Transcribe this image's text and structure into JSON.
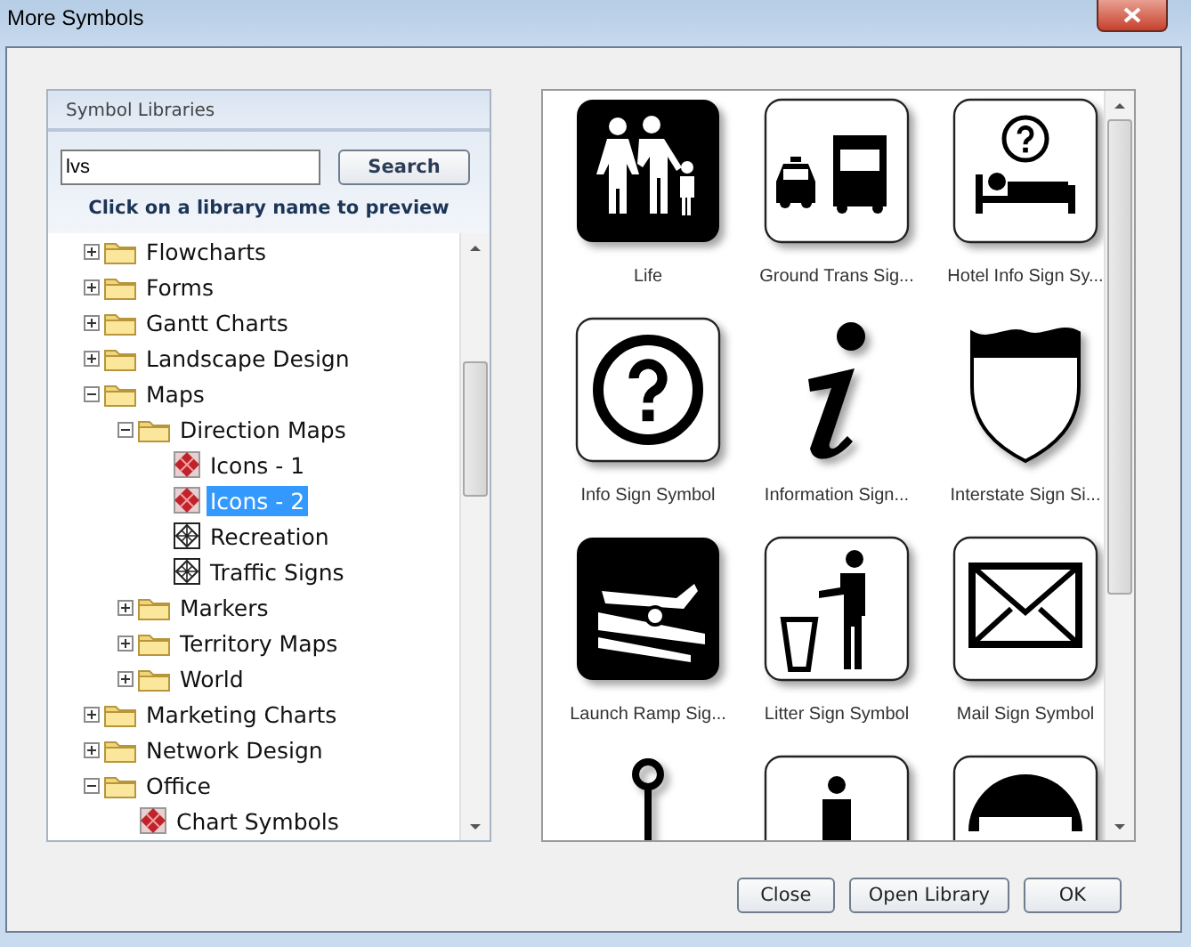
{
  "window": {
    "title": "More Symbols"
  },
  "libraries_panel": {
    "title": "Symbol Libraries",
    "search": {
      "value": "lvs"
    },
    "search_button": "Search",
    "hint": "Click on a library name to preview",
    "tree": [
      {
        "label": "Flowcharts",
        "kind": "folder",
        "expanded": false
      },
      {
        "label": "Forms",
        "kind": "folder",
        "expanded": false
      },
      {
        "label": "Gantt Charts",
        "kind": "folder",
        "expanded": false
      },
      {
        "label": "Landscape Design",
        "kind": "folder",
        "expanded": false
      },
      {
        "label": "Maps",
        "kind": "folder",
        "expanded": true,
        "children": [
          {
            "label": "Direction Maps",
            "kind": "folder",
            "expanded": true,
            "children": [
              {
                "label": "Icons - 1",
                "kind": "library",
                "selected": false
              },
              {
                "label": "Icons - 2",
                "kind": "library",
                "selected": true
              },
              {
                "label": "Recreation",
                "kind": "template",
                "selected": false
              },
              {
                "label": "Traffic Signs",
                "kind": "template",
                "selected": false
              }
            ]
          },
          {
            "label": "Markers",
            "kind": "folder",
            "expanded": false
          },
          {
            "label": "Territory Maps",
            "kind": "folder",
            "expanded": false
          },
          {
            "label": "World",
            "kind": "folder",
            "expanded": false
          }
        ]
      },
      {
        "label": "Marketing Charts",
        "kind": "folder",
        "expanded": false
      },
      {
        "label": "Network Design",
        "kind": "folder",
        "expanded": false
      },
      {
        "label": "Office",
        "kind": "folder",
        "expanded": true,
        "children": [
          {
            "label": "Chart Symbols",
            "kind": "library",
            "selected": false
          }
        ]
      }
    ]
  },
  "symbols": [
    {
      "label": "Life"
    },
    {
      "label": "Ground Trans Sig..."
    },
    {
      "label": "Hotel Info Sign Sy..."
    },
    {
      "label": "Info Sign Symbol"
    },
    {
      "label": "Information Sign..."
    },
    {
      "label": "Interstate Sign Si..."
    },
    {
      "label": "Launch Ramp Sig..."
    },
    {
      "label": "Litter Sign Symbol"
    },
    {
      "label": "Mail Sign Symbol"
    }
  ],
  "buttons": [
    "Close",
    "Open Library",
    "OK"
  ]
}
